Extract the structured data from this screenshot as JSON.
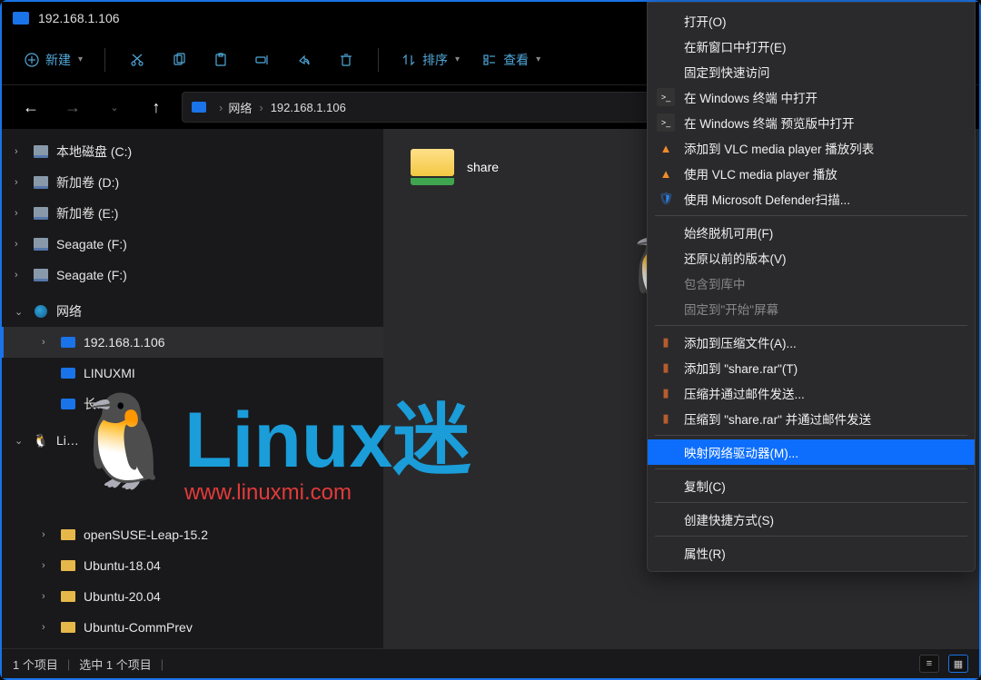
{
  "window": {
    "title": "192.168.1.106"
  },
  "toolbar": {
    "new_label": "新建",
    "sort_label": "排序",
    "view_label": "查看"
  },
  "breadcrumb": {
    "root": "网络",
    "current": "192.168.1.106"
  },
  "tree": {
    "local_c": "本地磁盘 (C:)",
    "vol_d": "新加卷 (D:)",
    "vol_e": "新加卷 (E:)",
    "seagate_f1": "Seagate (F:)",
    "seagate_f2": "Seagate (F:)",
    "network": "网络",
    "host": "192.168.1.106",
    "linuxmi": "LINUXMI",
    "chang": "长…",
    "li": "Li…",
    "opensuse": "openSUSE-Leap-15.2",
    "ubuntu1804": "Ubuntu-18.04",
    "ubuntu2004": "Ubuntu-20.04",
    "ubuntucomm": "Ubuntu-CommPrev"
  },
  "content": {
    "folder_share": "share"
  },
  "ctx": {
    "open": "打开(O)",
    "open_new_win": "在新窗口中打开(E)",
    "pin_quick": "固定到快速访问",
    "win_terminal": "在 Windows 终端 中打开",
    "win_terminal_preview": "在 Windows 终端 预览版中打开",
    "vlc_add": "添加到 VLC media player 播放列表",
    "vlc_play": "使用 VLC media player 播放",
    "defender": "使用 Microsoft Defender扫描...",
    "offline": "始终脱机可用(F)",
    "prev_ver": "还原以前的版本(V)",
    "include_lib": "包含到库中",
    "pin_start": "固定到\"开始\"屏幕",
    "add_archive": "添加到压缩文件(A)...",
    "add_share_rar": "添加到 \"share.rar\"(T)",
    "compress_email": "压缩并通过邮件发送...",
    "compress_share_email": "压缩到 \"share.rar\" 并通过邮件发送",
    "map_drive": "映射网络驱动器(M)...",
    "copy": "复制(C)",
    "create_shortcut": "创建快捷方式(S)",
    "properties": "属性(R)"
  },
  "status": {
    "count": "1 个项目",
    "selected": "选中 1 个项目"
  },
  "watermark": {
    "title": "Linux迷",
    "url": "www.linuxmi.com"
  }
}
